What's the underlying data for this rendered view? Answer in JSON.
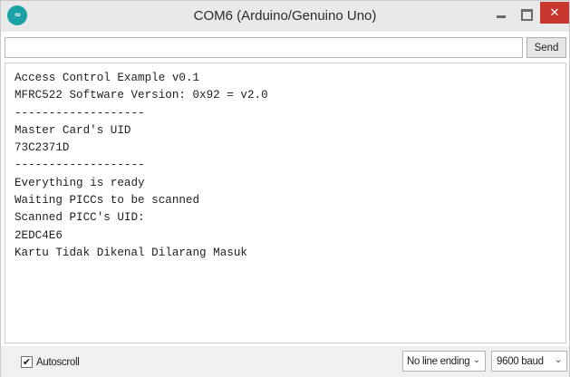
{
  "window": {
    "title": "COM6 (Arduino/Genuino Uno)",
    "app_icon_glyph": "∞",
    "close_glyph": "✕"
  },
  "input_row": {
    "value": "",
    "send_label": "Send"
  },
  "output": {
    "lines": [
      "Access Control Example v0.1",
      "MFRC522 Software Version: 0x92 = v2.0",
      "-------------------",
      "Master Card's UID",
      "73C2371D",
      "-------------------",
      "Everything is ready",
      "Waiting PICCs to be scanned",
      "Scanned PICC's UID:",
      "2EDC4E6",
      "Kartu Tidak Dikenal Dilarang Masuk"
    ]
  },
  "bottom_bar": {
    "autoscroll_label": "Autoscroll",
    "autoscroll_checked": true,
    "check_glyph": "✔",
    "line_ending": "No line ending",
    "baud_rate": "9600 baud",
    "dropdown_glyph": "⌄"
  },
  "colors": {
    "title_bar": "#e9e9e9",
    "app_icon": "#1aa2a6",
    "close_button": "#c7372d"
  },
  "icons": [
    "app-icon",
    "minimize-icon",
    "maximize-icon",
    "close-icon",
    "checkmark-icon",
    "chevron-down-icon"
  ]
}
